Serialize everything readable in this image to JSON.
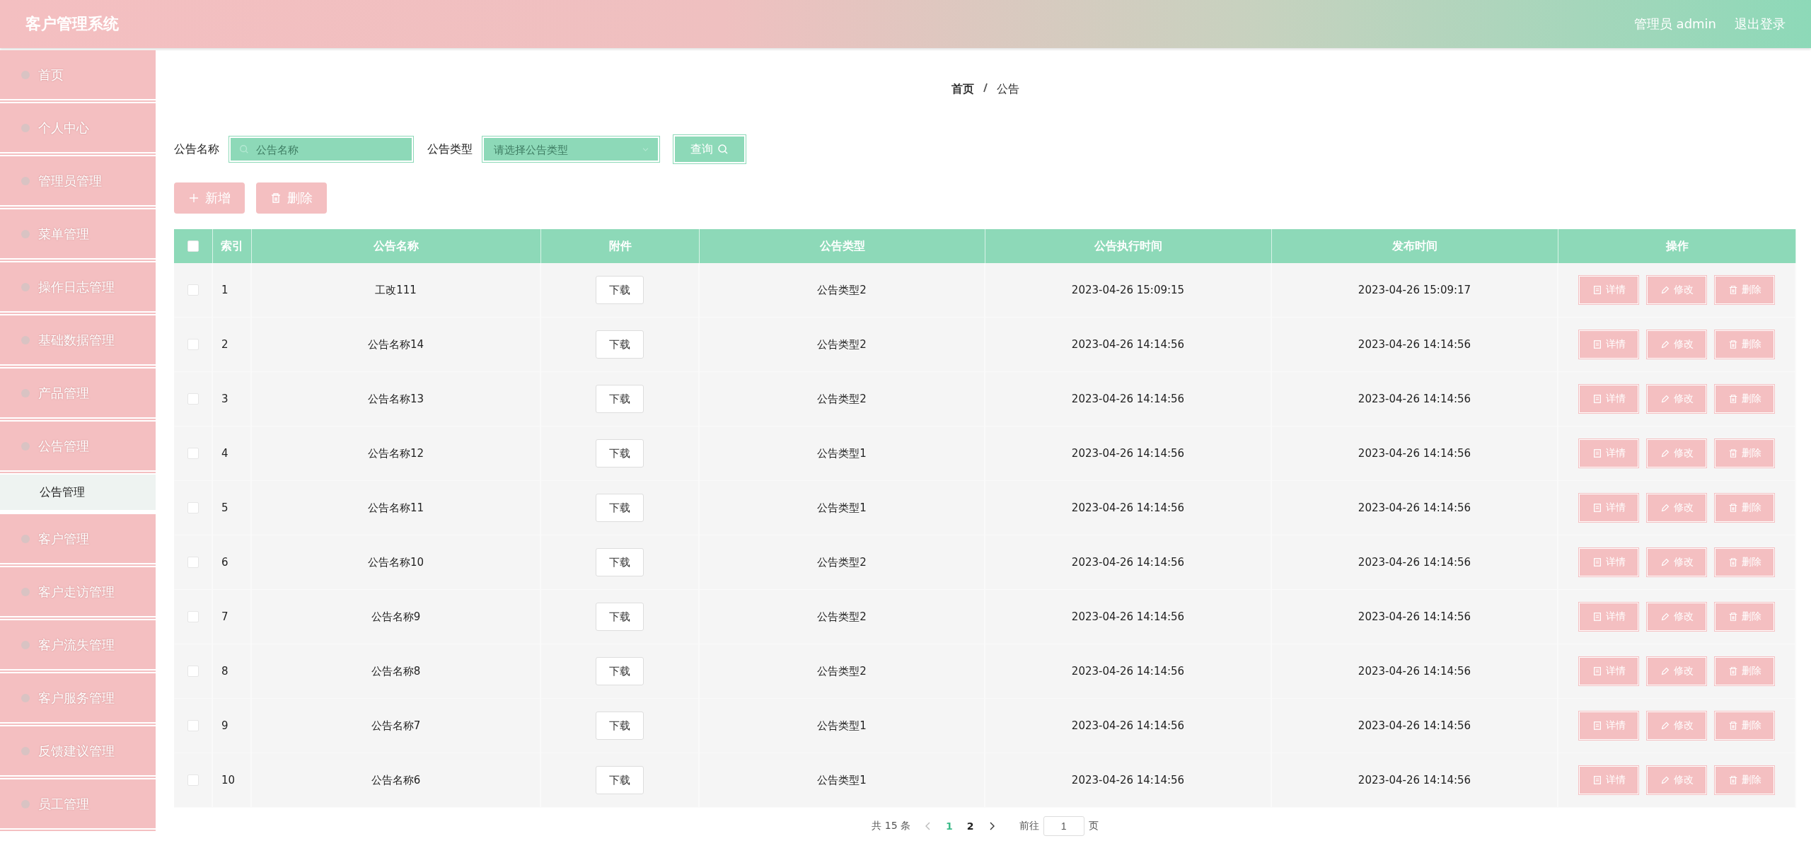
{
  "header": {
    "title": "客户管理系统",
    "user": "管理员 admin",
    "logout": "退出登录"
  },
  "sidebar": {
    "items": [
      {
        "label": "首页"
      },
      {
        "label": "个人中心"
      },
      {
        "label": "管理员管理"
      },
      {
        "label": "菜单管理"
      },
      {
        "label": "操作日志管理"
      },
      {
        "label": "基础数据管理"
      },
      {
        "label": "产品管理"
      },
      {
        "label": "公告管理",
        "children": [
          {
            "label": "公告管理",
            "selected": true
          }
        ]
      },
      {
        "label": "客户管理"
      },
      {
        "label": "客户走访管理"
      },
      {
        "label": "客户流失管理"
      },
      {
        "label": "客户服务管理"
      },
      {
        "label": "反馈建议管理"
      },
      {
        "label": "员工管理"
      }
    ]
  },
  "breadcrumb": [
    "首页",
    "公告"
  ],
  "search": {
    "name_label": "公告名称",
    "name_placeholder": "公告名称",
    "type_label": "公告类型",
    "type_placeholder": "请选择公告类型",
    "button": "查询"
  },
  "actions": {
    "add": "新增",
    "delete": "删除"
  },
  "table": {
    "columns": [
      "索引",
      "公告名称",
      "附件",
      "公告类型",
      "公告执行时间",
      "发布时间",
      "操作"
    ],
    "all_checked": false,
    "rows": [
      {
        "checked": false,
        "index": "1",
        "name": "工改111",
        "attachment": "下载",
        "type": "公告类型2",
        "exec_time": "2023-04-26 15:09:15",
        "publish_time": "2023-04-26 15:09:17",
        "ops": [
          "详情",
          "修改",
          "删除"
        ]
      },
      {
        "checked": false,
        "index": "2",
        "name": "公告名称14",
        "attachment": "下载",
        "type": "公告类型2",
        "exec_time": "2023-04-26 14:14:56",
        "publish_time": "2023-04-26 14:14:56",
        "ops": [
          "详情",
          "修改",
          "删除"
        ]
      },
      {
        "checked": false,
        "index": "3",
        "name": "公告名称13",
        "attachment": "下载",
        "type": "公告类型2",
        "exec_time": "2023-04-26 14:14:56",
        "publish_time": "2023-04-26 14:14:56",
        "ops": [
          "详情",
          "修改",
          "删除"
        ]
      },
      {
        "checked": false,
        "index": "4",
        "name": "公告名称12",
        "attachment": "下载",
        "type": "公告类型1",
        "exec_time": "2023-04-26 14:14:56",
        "publish_time": "2023-04-26 14:14:56",
        "ops": [
          "详情",
          "修改",
          "删除"
        ]
      },
      {
        "checked": false,
        "index": "5",
        "name": "公告名称11",
        "attachment": "下载",
        "type": "公告类型1",
        "exec_time": "2023-04-26 14:14:56",
        "publish_time": "2023-04-26 14:14:56",
        "ops": [
          "详情",
          "修改",
          "删除"
        ]
      },
      {
        "checked": false,
        "index": "6",
        "name": "公告名称10",
        "attachment": "下载",
        "type": "公告类型2",
        "exec_time": "2023-04-26 14:14:56",
        "publish_time": "2023-04-26 14:14:56",
        "ops": [
          "详情",
          "修改",
          "删除"
        ]
      },
      {
        "checked": false,
        "index": "7",
        "name": "公告名称9",
        "attachment": "下载",
        "type": "公告类型2",
        "exec_time": "2023-04-26 14:14:56",
        "publish_time": "2023-04-26 14:14:56",
        "ops": [
          "详情",
          "修改",
          "删除"
        ]
      },
      {
        "checked": false,
        "index": "8",
        "name": "公告名称8",
        "attachment": "下载",
        "type": "公告类型2",
        "exec_time": "2023-04-26 14:14:56",
        "publish_time": "2023-04-26 14:14:56",
        "ops": [
          "详情",
          "修改",
          "删除"
        ]
      },
      {
        "checked": false,
        "index": "9",
        "name": "公告名称7",
        "attachment": "下载",
        "type": "公告类型1",
        "exec_time": "2023-04-26 14:14:56",
        "publish_time": "2023-04-26 14:14:56",
        "ops": [
          "详情",
          "修改",
          "删除"
        ]
      },
      {
        "checked": false,
        "index": "10",
        "name": "公告名称6",
        "attachment": "下载",
        "type": "公告类型1",
        "exec_time": "2023-04-26 14:14:56",
        "publish_time": "2023-04-26 14:14:56",
        "ops": [
          "详情",
          "修改",
          "删除"
        ]
      }
    ]
  },
  "pagination": {
    "total": "共 15 条",
    "pages": [
      {
        "label": "1",
        "selected": true
      },
      {
        "label": "2",
        "selected": false
      }
    ],
    "goto_label": "前往",
    "goto_value": "1",
    "page_unit": "页"
  }
}
